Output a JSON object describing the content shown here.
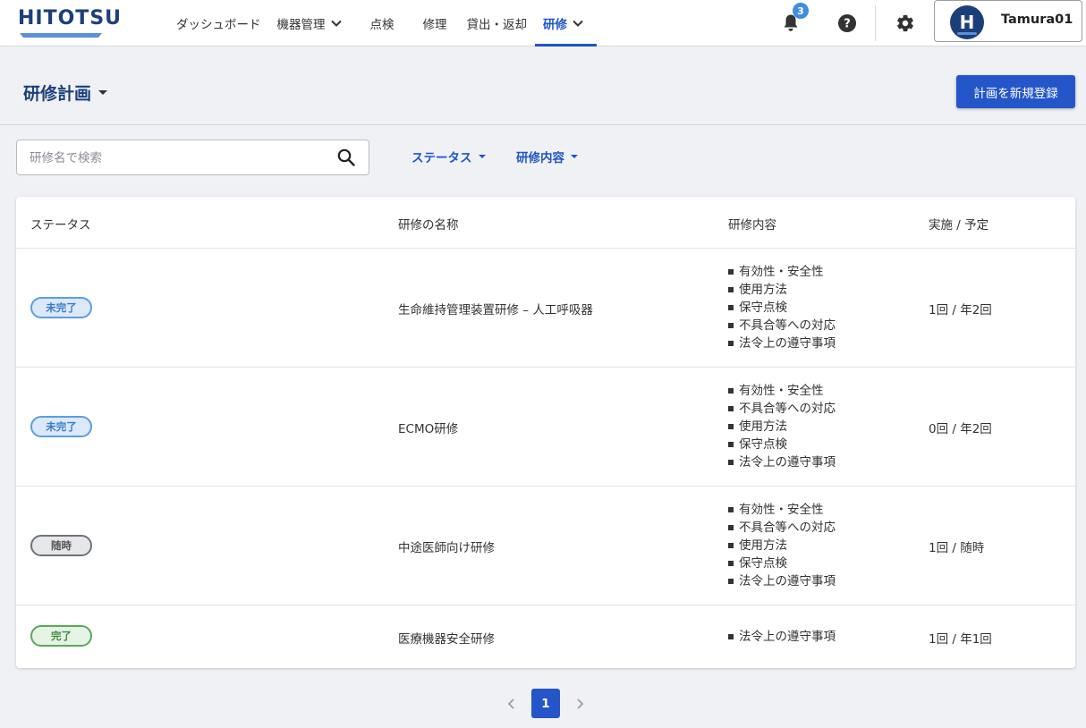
{
  "header": {
    "logo_text": "HITOTSU",
    "nav": [
      {
        "label": "ダッシュボード",
        "has_chevron": false,
        "active": false
      },
      {
        "label": "機器管理",
        "has_chevron": true,
        "active": false
      },
      {
        "label": "点検",
        "has_chevron": false,
        "active": false
      },
      {
        "label": "修理",
        "has_chevron": false,
        "active": false
      },
      {
        "label": "貸出・返却",
        "has_chevron": false,
        "active": false
      },
      {
        "label": "研修",
        "has_chevron": true,
        "active": true
      }
    ],
    "notification_count": "3",
    "user": {
      "initial": "H",
      "name": "Tamura01"
    }
  },
  "page": {
    "title": "研修計画",
    "new_button_label": "計画を新規登録"
  },
  "filters": {
    "search_placeholder": "研修名で検索",
    "status_label": "ステータス",
    "content_label": "研修内容"
  },
  "table": {
    "headers": {
      "status": "ステータス",
      "name": "研修の名称",
      "content": "研修内容",
      "count": "実施 / 予定"
    },
    "rows": [
      {
        "status": "未完了",
        "status_type": "incomplete",
        "name": "生命維持管理装置研修 – 人工呼吸器",
        "content": [
          "有効性・安全性",
          "使用方法",
          "保守点検",
          "不具合等への対応",
          "法令上の遵守事項"
        ],
        "count": "1回 / 年2回"
      },
      {
        "status": "未完了",
        "status_type": "incomplete",
        "name": "ECMO研修",
        "content": [
          "有効性・安全性",
          "不具合等への対応",
          "使用方法",
          "保守点検",
          "法令上の遵守事項"
        ],
        "count": "0回 / 年2回"
      },
      {
        "status": "随時",
        "status_type": "anytime",
        "name": "中途医師向け研修",
        "content": [
          "有効性・安全性",
          "不具合等への対応",
          "使用方法",
          "保守点検",
          "法令上の遵守事項"
        ],
        "count": "1回 / 随時"
      },
      {
        "status": "完了",
        "status_type": "complete",
        "name": "医療機器安全研修",
        "content": [
          "法令上の遵守事項"
        ],
        "count": "1回 / 年1回"
      }
    ]
  },
  "pagination": {
    "current_page": "1"
  },
  "colors": {
    "brand": "#1c3f7c",
    "primary": "#2456c9",
    "link": "#1d55c4",
    "background": "#f0f1f5"
  },
  "icons": [
    "logo-bar-icon",
    "chevron-down-icon",
    "bell-icon",
    "help-icon",
    "gear-icon",
    "search-icon",
    "caret-down-icon",
    "chevron-left-icon",
    "chevron-right-icon"
  ]
}
